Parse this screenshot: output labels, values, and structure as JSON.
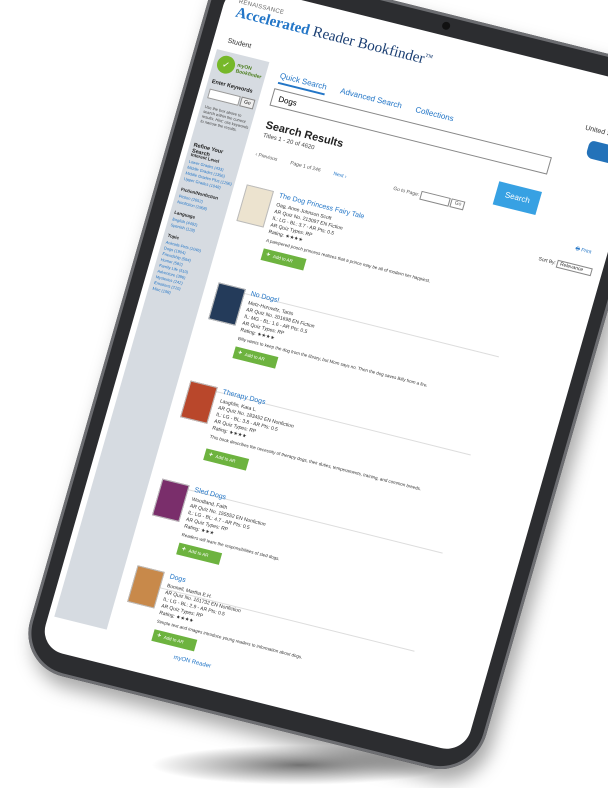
{
  "brand": {
    "small": "RENAISSANCE",
    "name_bold": "Accelerated",
    "name_rest": " Reader Bookfinder",
    "tm": "™"
  },
  "header": {
    "role": "Student",
    "country": "United States"
  },
  "tabs": [
    "Quick Search",
    "Advanced Search",
    "Collections"
  ],
  "search": {
    "value": "Dogs",
    "button": "Search"
  },
  "results": {
    "title": "Search Results",
    "count": "Titles 1 - 20 of 4620"
  },
  "pager": {
    "prev": "‹ Previous",
    "page": "Page 1 of 246",
    "next": "Next ›",
    "goto": "Go to Page:",
    "go": "Go",
    "print": "Print",
    "sort_label": "Sort By:",
    "sort_value": "Relevance"
  },
  "sidebar": {
    "logo": "myON Bookfinder",
    "enter_keywords": "Enter Keywords",
    "go": "Go",
    "help_text": "Use the box above to search within the current results. Hint: use keywords to narrow the results.",
    "refine": "Refine Your Search",
    "interest_level": "Interest Level",
    "levels": [
      "Lower Grades (433)",
      "Middle Grades (1356)",
      "Middle Grades Plus (1296)",
      "Upper Grades (1048)"
    ],
    "fiction_label": "Fiction/Nonfiction",
    "fiction": [
      "Fiction (2652)",
      "Nonfiction (1968)"
    ],
    "language_label": "Language",
    "languages": [
      "English (4492)",
      "Spanish (128)"
    ],
    "topic_label": "Topic",
    "topics": [
      "Animals-Pets (1046)",
      "Dogs (1904)",
      "Friendship (594)",
      "Humor (582)",
      "Family Life (510)",
      "Adventure (396)",
      "Mysteries (242)",
      "Emotions (210)",
      "Misc (198)"
    ]
  },
  "books": [
    {
      "title": "The Dog Princess Fairy Tale",
      "author": "Oag, Anne Johnson Scott",
      "quiz": "AR Quiz No. 213097 EN Fiction",
      "levels": "IL: LG - BL: 3.7 - AR Pts: 0.5",
      "quiz_types": "AR Quiz Types: RP",
      "rating": "Rating: ★★★★",
      "desc": "A pampered pooch princess realizes that a prince may be all of modern her happiest.",
      "add": "Add to AR Bookbag",
      "cover_color": "#ece3cf"
    },
    {
      "title": "No Dogs!",
      "author": "Metz-Horowitz, Tanis",
      "quiz": "AR Quiz No. 201698 EN Fiction",
      "levels": "IL: MG - BL: 1.6 - AR Pts: 0.5",
      "quiz_types": "AR Quiz Types: RP",
      "rating": "Rating: ★★★★",
      "desc": "Billy wants to keep the dog from the library, but Mom says no. Then the dog saves Billy from a fire.",
      "add": "Add to AR Bookbag",
      "cover_color": "#243b5a"
    },
    {
      "title": "Therapy Dogs",
      "author": "Laughlin, Kara L.",
      "quiz": "AR Quiz No. 183452 EN Nonfiction",
      "levels": "IL: LG - BL: 3.8 - AR Pts: 0.5",
      "quiz_types": "AR Quiz Types: RP",
      "rating": "Rating: ★★★★",
      "desc": "This book describes the necessity of therapy dogs, their duties, temperaments, training, and common breeds.",
      "add": "Add to AR Bookbag",
      "cover_color": "#b9472b"
    },
    {
      "title": "Sled Dogs",
      "author": "Woodland, Faith",
      "quiz": "AR Quiz No. 155552 EN Nonfiction",
      "levels": "IL: LG - BL: 4.7 - AR Pts: 0.5",
      "quiz_types": "AR Quiz Types: RP",
      "rating": "Rating: ★★★",
      "desc": "Readers will learn the responsibilities of sled dogs.",
      "add": "Add to AR Bookbag",
      "cover_color": "#7a2e6b"
    },
    {
      "title": "Dogs",
      "author": "Bonnell, Martha E.H.",
      "quiz": "AR Quiz No. 161732 EN Nonfiction",
      "levels": "IL: LG - BL: 2.9 - AR Pts: 0.5",
      "quiz_types": "AR Quiz Types: RP",
      "rating": "Rating: ★★★★",
      "desc": "Simple text and images introduce young readers to information about dogs.",
      "add": "Add to AR Bookbag",
      "cover_color": "#c8894a"
    }
  ],
  "footer": {
    "logo": "myON Reader"
  }
}
